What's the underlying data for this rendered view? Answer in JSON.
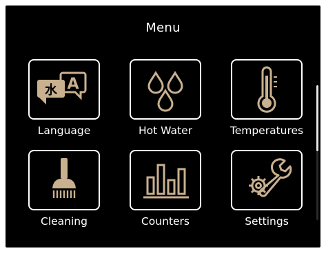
{
  "header": {
    "title": "Menu"
  },
  "tiles": [
    {
      "label": "Language",
      "icon": "language-icon"
    },
    {
      "label": "Hot Water",
      "icon": "hot-water-drops-icon"
    },
    {
      "label": "Temperatures",
      "icon": "thermometer-icon"
    },
    {
      "label": "Cleaning",
      "icon": "cleaning-brush-icon"
    },
    {
      "label": "Counters",
      "icon": "counters-bar-chart-icon"
    },
    {
      "label": "Settings",
      "icon": "settings-gear-wrench-icon"
    }
  ],
  "colors": {
    "background": "#000000",
    "foreground": "#ffffff",
    "icon_accent": "#c9b190"
  }
}
